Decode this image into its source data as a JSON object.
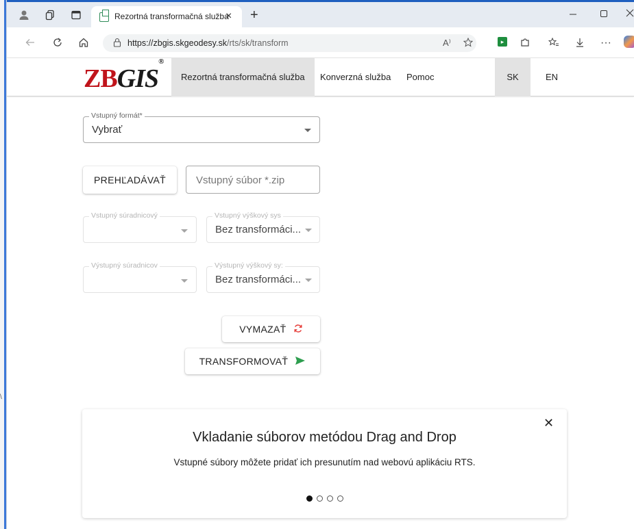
{
  "browser": {
    "tab_title": "Rezortná transformačná služba",
    "tab_close": "×",
    "new_tab": "+",
    "url_host": "https://zbgis.skgeodesy.sk",
    "url_path": "/rts/sk/transform",
    "read_aloud": "A⁾",
    "more": "···"
  },
  "app": {
    "logo_zb": "ZB",
    "logo_gis": "GIS",
    "logo_reg": "®",
    "nav": [
      {
        "label": "Rezortná transformačná služba",
        "active": true
      },
      {
        "label": "Konverzná služba",
        "active": false
      },
      {
        "label": "Pomoc",
        "active": false
      }
    ],
    "lang": [
      {
        "label": "SK",
        "active": true
      },
      {
        "label": "EN",
        "active": false
      }
    ]
  },
  "form": {
    "input_format_label": "Vstupný formát*",
    "input_format_value": "Vybrať",
    "browse_button": "PREHĽADÁVAŤ",
    "file_placeholder": "Vstupný súbor *.zip",
    "in_coord_label": "Vstupný súradnicový",
    "in_coord_value": "",
    "in_height_label": "Vstupný výškový sys",
    "in_height_value": "Bez transformáci...",
    "out_coord_label": "Výstupný súradnicov",
    "out_coord_value": "",
    "out_height_label": "Výstupný výškový sy:",
    "out_height_value": "Bez transformáci...",
    "clear_button": "VYMAZAŤ",
    "transform_button": "TRANSFORMOVAŤ"
  },
  "info_card": {
    "title": "Vkladanie súborov metódou Drag and Drop",
    "text": "Vstupné súbory môžete pridať ich presunutím nad webovú aplikáciu RTS.",
    "pages": 4,
    "current_page": 1
  },
  "colors": {
    "logo_red": "#c0141b",
    "refresh_red": "#e53935",
    "send_green": "#2e9e4f",
    "active_nav_bg": "#e3e3e3"
  },
  "icons": [
    "profile-icon",
    "workspaces-icon",
    "tab-actions-icon",
    "back-icon",
    "refresh-icon",
    "home-icon",
    "lock-icon",
    "favorites-icon",
    "extension-icon",
    "collections-icon",
    "downloads-icon",
    "copilot-icon",
    "refresh-red-icon",
    "send-icon",
    "close-icon"
  ]
}
